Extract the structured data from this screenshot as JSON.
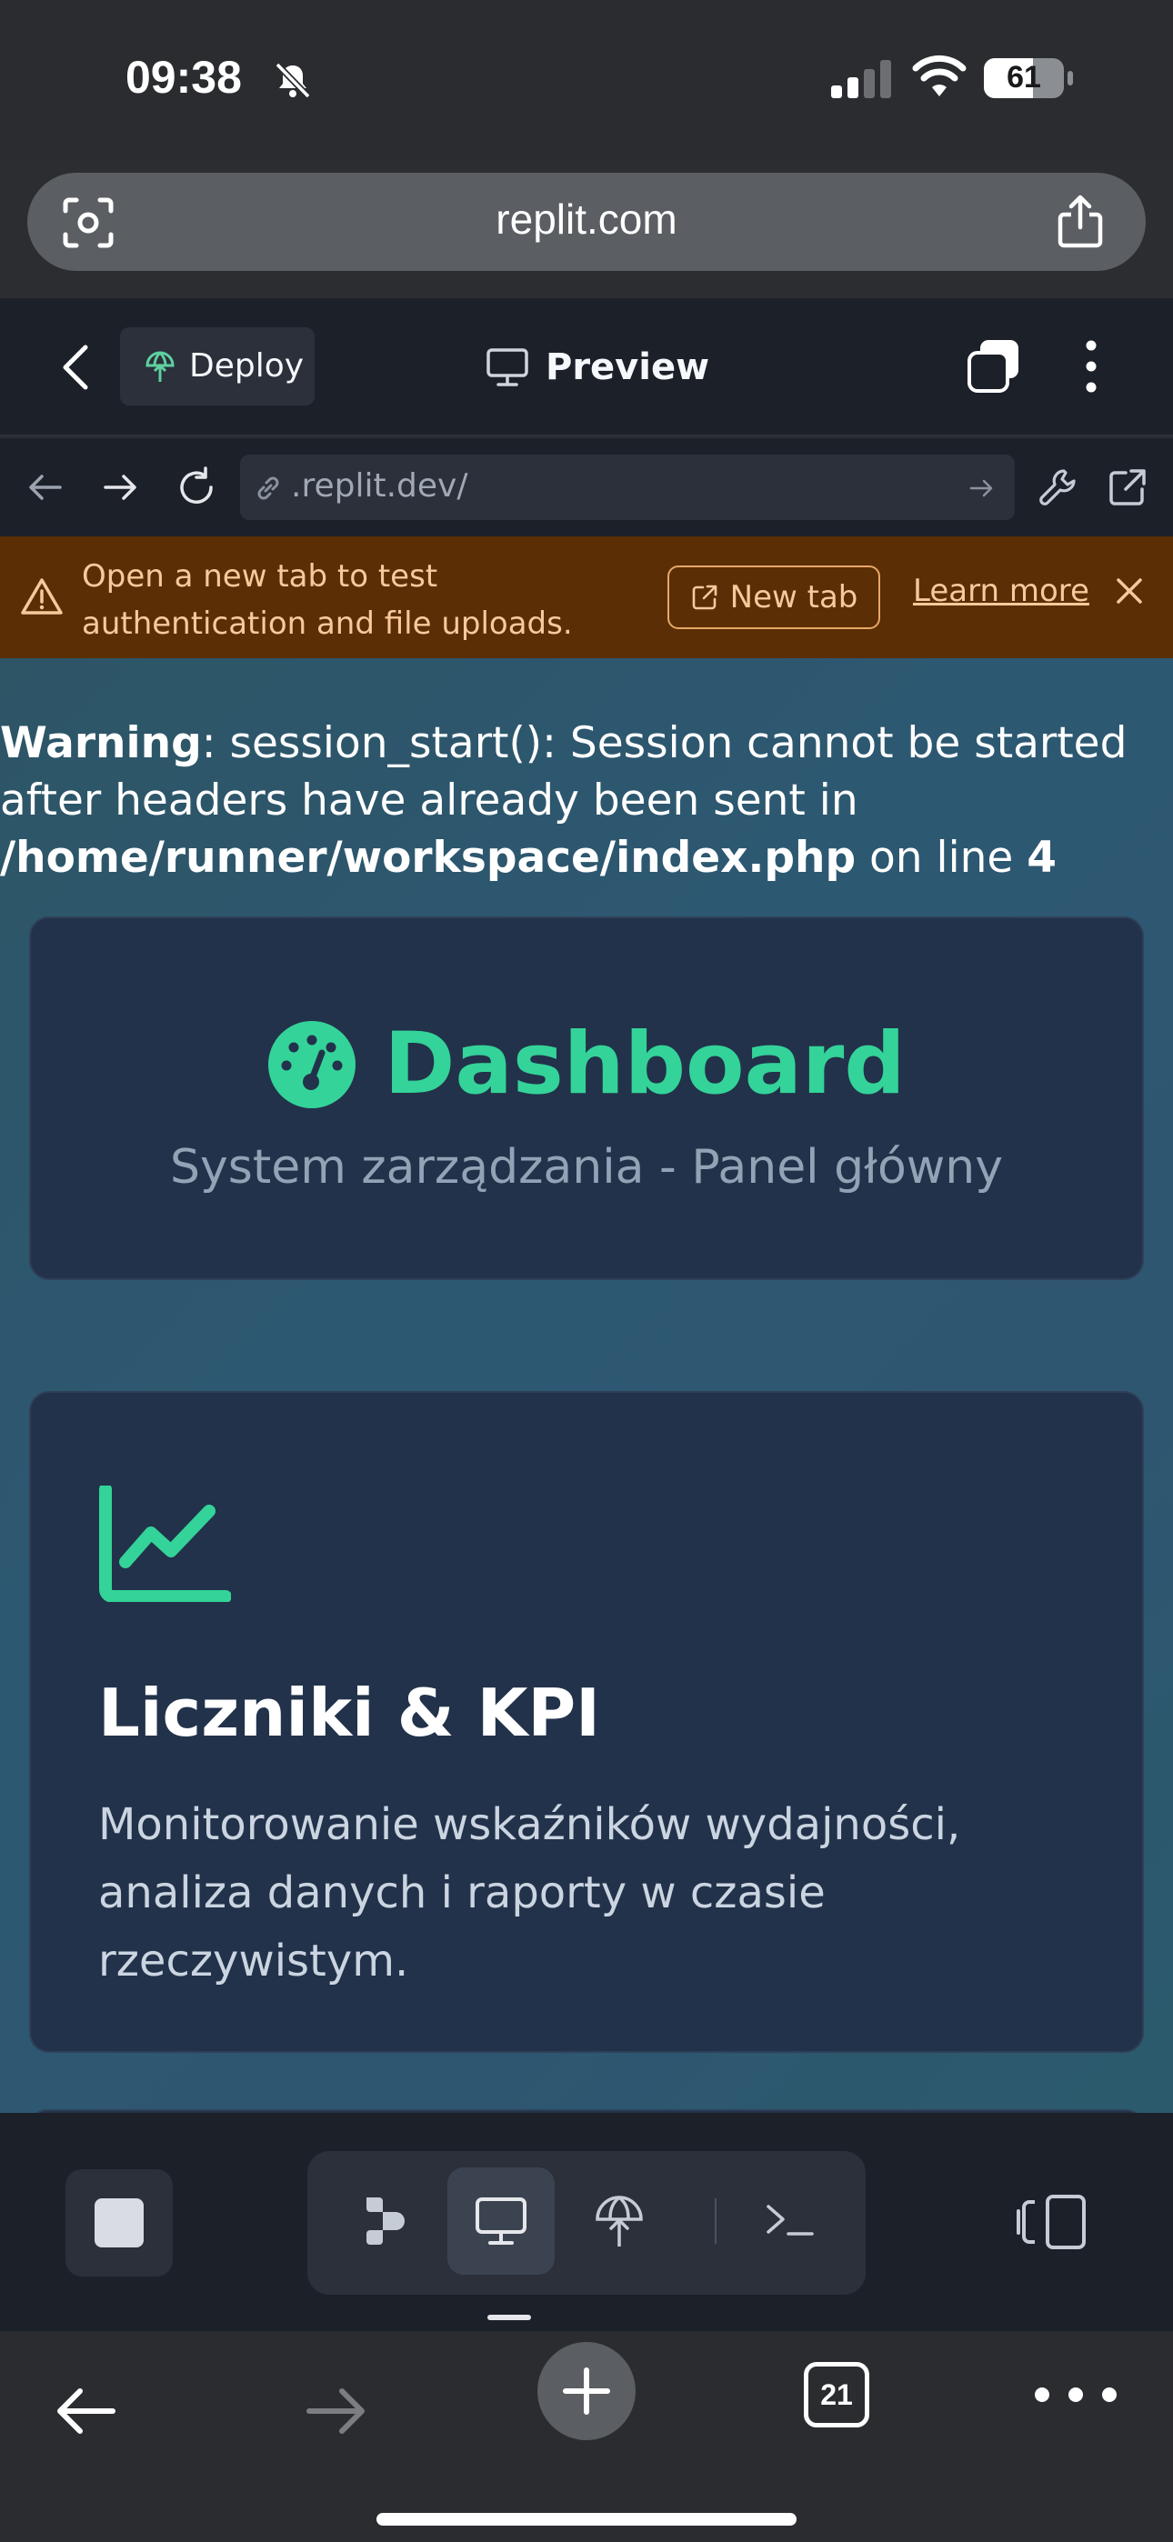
{
  "status_bar": {
    "time": "09:38",
    "battery": "61"
  },
  "browser": {
    "url": "replit.com",
    "open_tabs": "21"
  },
  "replit": {
    "deploy_label": "Deploy",
    "preview_label": "Preview",
    "address": ".replit.dev/"
  },
  "banner": {
    "message": "Open a new tab to test authentication and file uploads.",
    "new_tab_label": "New tab",
    "learn_more_label": "Learn more"
  },
  "php_warning": {
    "label": "Warning",
    "message": ": session_start(): Session cannot be started after headers have already been sent in ",
    "path": "/home/runner/workspace/index.php",
    "on_line": " on line ",
    "line": "4"
  },
  "dashboard": {
    "title": "Dashboard",
    "subtitle": "System zarządzania - Panel główny"
  },
  "kpi_card": {
    "title": "Liczniki & KPI",
    "description": "Monitorowanie wskaźników wydajności, analiza danych i raporty w czasie rzeczywistym."
  },
  "colors": {
    "accent_green": "#34d399",
    "banner_bg": "#5b2e06",
    "banner_text": "#f7c99b",
    "card_bg": "#22324a"
  }
}
